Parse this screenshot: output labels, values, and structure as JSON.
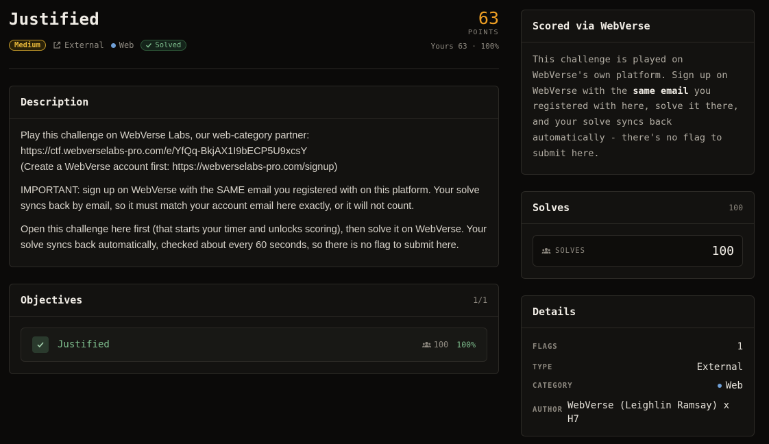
{
  "challenge": {
    "title": "Justified",
    "difficulty": "Medium",
    "source": "External",
    "category": "Web",
    "status": "Solved",
    "points": "63",
    "points_label": "POINTS",
    "yours": "Yours 63 · 100%"
  },
  "description": {
    "heading": "Description",
    "line1": "Play this challenge on WebVerse Labs, our web-category partner:",
    "line2": "https://ctf.webverselabs-pro.com/e/YfQq-BkjAX1I9bECP5U9xcsY",
    "line3": "(Create a WebVerse account first: https://webverselabs-pro.com/signup)",
    "para2": "IMPORTANT: sign up on WebVerse with the SAME email you registered with on this platform. Your solve syncs back by email, so it must match your account email here exactly, or it will not count.",
    "para3": "Open this challenge here first (that starts your timer and unlocks scoring), then solve it on WebVerse. Your solve syncs back automatically, checked about every 60 seconds, so there is no flag to submit here."
  },
  "objectives": {
    "heading": "Objectives",
    "count": "1/1",
    "items": [
      {
        "name": "Justified",
        "solves": "100",
        "percent": "100%"
      }
    ]
  },
  "scored": {
    "heading": "Scored via WebVerse",
    "text_before": "This challenge is played on WebVerse's own platform. Sign up on WebVerse with the ",
    "text_bold": "same email",
    "text_after": " you registered with here, solve it there, and your solve syncs back automatically - there's no flag to submit here."
  },
  "solves": {
    "heading": "Solves",
    "count": "100",
    "label": "SOLVES",
    "value": "100"
  },
  "details": {
    "heading": "Details",
    "flags_label": "FLAGS",
    "flags_value": "1",
    "type_label": "TYPE",
    "type_value": "External",
    "category_label": "CATEGORY",
    "category_value": "Web",
    "author_label": "AUTHOR",
    "author_value": "WebVerse (Leighlin Ramsay) x H7"
  },
  "colors": {
    "accent_orange": "#f0a024",
    "medium_badge": "#e8b83a",
    "solved_green": "#7fc08f",
    "web_dot": "#6f9fd6"
  },
  "icons": [
    "external-link-icon",
    "check-icon",
    "users-icon"
  ]
}
